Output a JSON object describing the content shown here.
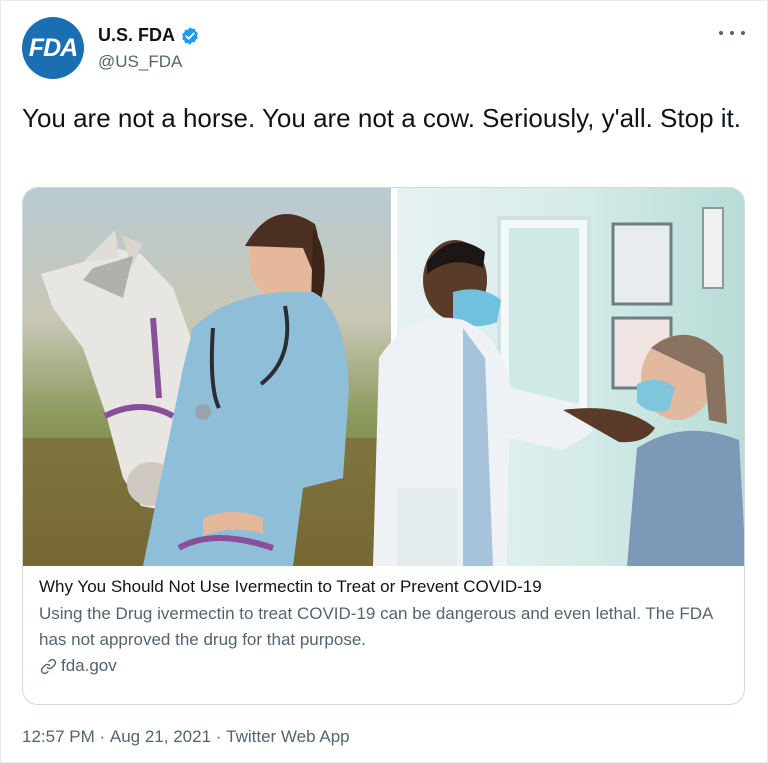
{
  "author": {
    "avatar_text": "FDA",
    "display_name": "U.S. FDA",
    "handle": "@US_FDA",
    "verified": true,
    "avatar_color": "#1a6fb3",
    "verified_color": "#1d9bf0"
  },
  "tweet": {
    "text": "You are not a horse. You are not a cow. Seriously, y'all. Stop it."
  },
  "card": {
    "title": "Why You Should Not Use Ivermectin to Treat or Prevent COVID-19",
    "description": "Using the Drug ivermectin to treat COVID-19 can be dangerous and even lethal. The FDA has not approved the drug for that purpose.",
    "domain": "fda.gov",
    "domain_icon": "link-icon"
  },
  "meta": {
    "time": "12:57 PM",
    "separator": " · ",
    "date": "Aug 21, 2021",
    "source": "Twitter Web App"
  },
  "icons": {
    "more": "more-icon",
    "verified": "verified-badge-icon"
  }
}
